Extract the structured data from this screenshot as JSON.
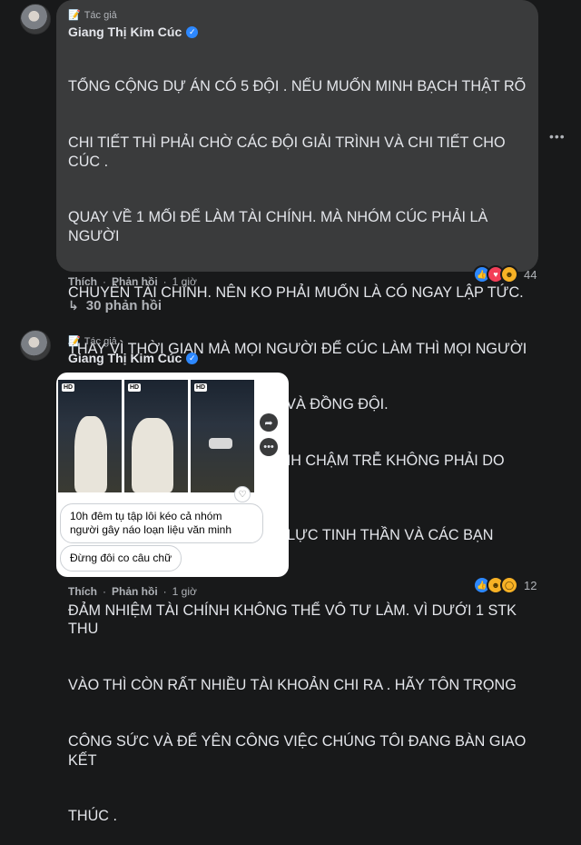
{
  "comments": [
    {
      "badge": "Tác giả",
      "author": "Giang Thị Kim Cúc",
      "text_lines": [
        "TỔNG CỘNG DỰ ÁN CÓ 5 ĐỘI . NẾU MUỐN MINH BẠCH THẬT RÕ",
        "CHI TIẾT THÌ PHẢI CHỜ CÁC ĐỘI GIẢI TRÌNH VÀ CHI TIẾT CHO CÚC .",
        "QUAY VỀ 1 MỐI ĐỂ LÀM TÀI CHÍNH. MÀ NHÓM CÚC PHẢI LÀ NGƯỜI",
        "CHUYÊN TÀI CHÍNH. NÊN KO PHẢI MUỐN LÀ CÓ NGAY LẬP TỨC.",
        "THAY VÌ THỜI GIAN MÀ MỌI NGƯỜI ĐỂ CÚC LÀM THÌ MỌI NGƯỜI",
        "TRA TẤN TINH THẦN CỦA CÚC VÀ ĐỒNG ĐỘI.",
        "NÊN VIỆC MINH BẠCH TÀI CHÍNH CHẬM TRỄ KHÔNG PHẢI DO RIÊNG",
        "CÚC MÀ PHẦN VÌ DƯ LUẬN ÁP LỰC TINH THẦN VÀ CÁC BẠN ĐANG",
        "ĐẢM NHIỆM TÀI CHÍNH KHÔNG THỂ VÔ TƯ LÀM. VÌ DƯỚI 1 STK THU",
        "VÀO THÌ CÒN RẤT NHIỀU TÀI KHOẢN CHI RA . HÃY TÔN TRỌNG",
        "CÔNG SỨC VÀ ĐỂ YÊN CÔNG VIỆC CHÚNG TÔI ĐANG BÀN GIAO KẾT",
        "THÚC ."
      ],
      "like_label": "Thích",
      "reply_label": "Phản hồi",
      "time": "1 giờ",
      "reaction_count": "44",
      "replies_label": "30 phản hồi",
      "more_icon": "more-dots-icon"
    },
    {
      "badge": "Tác giả",
      "author": "Giang Thị Kim Cúc",
      "hd_label": "HD",
      "caption_1": "10h đêm tụ tập lôi kéo cả nhóm người gây náo loạn liệu văn minh",
      "caption_2": "Đừng đôi co câu chữ",
      "like_label": "Thích",
      "reply_label": "Phản hồi",
      "time": "1 giờ",
      "reaction_count": "12"
    }
  ],
  "colors": {
    "background": "#18191a",
    "bubble": "#3a3b3c",
    "text": "#e4e6eb",
    "secondary": "#b0b3b8",
    "verified": "#2d88ff"
  }
}
